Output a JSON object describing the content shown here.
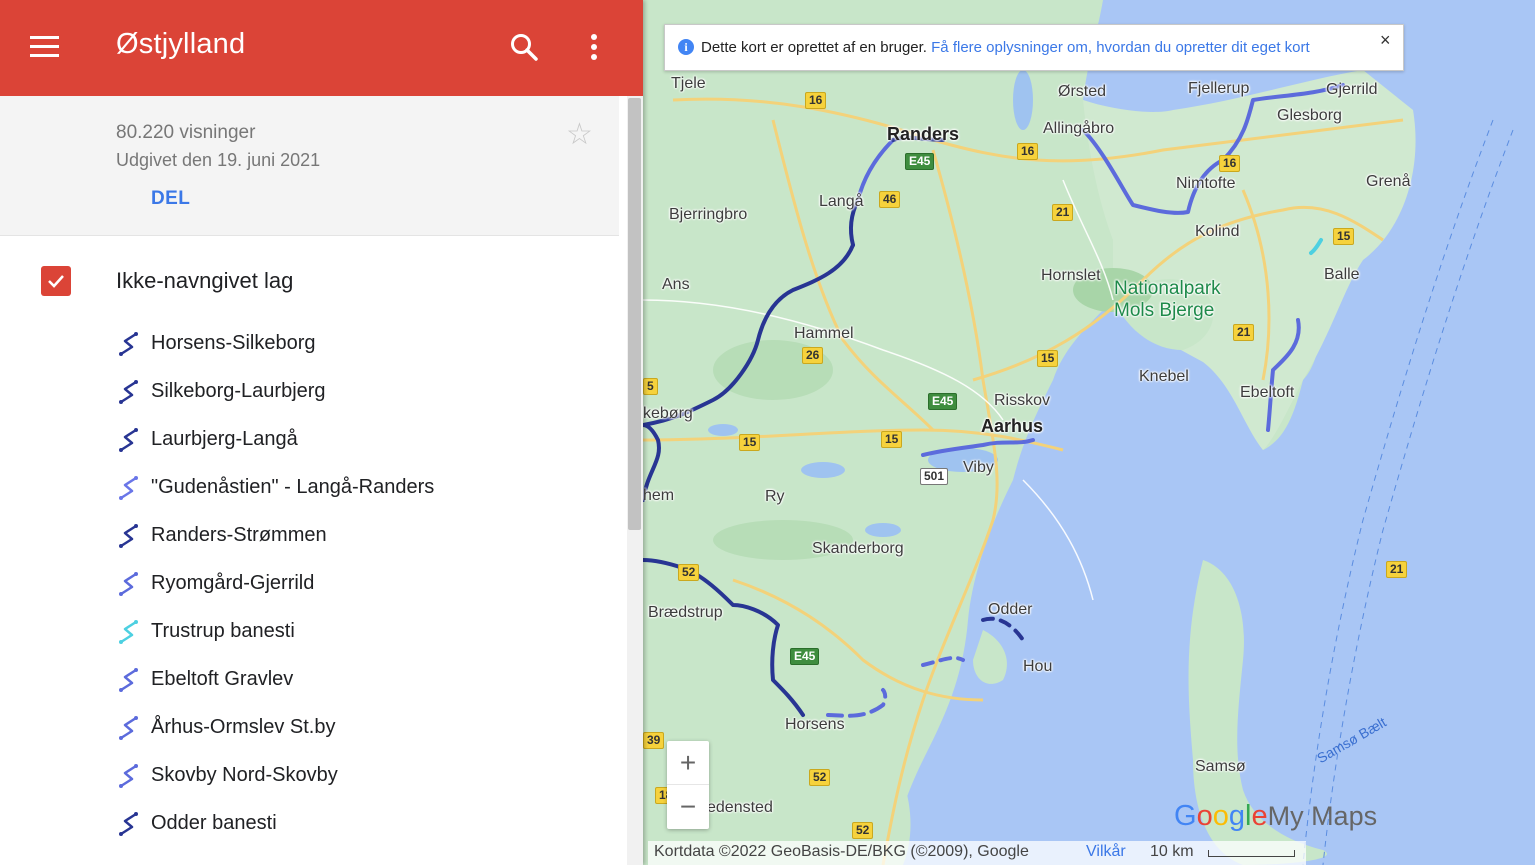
{
  "header": {
    "title": "Østjylland",
    "menu_icon": "menu-icon",
    "search_icon": "search-icon",
    "more_icon": "more-vert-icon",
    "color": "#db4437"
  },
  "info": {
    "views": "80.220 visninger",
    "published": "Udgivet den 19. juni 2021",
    "share_label": "DEL",
    "star_icon": "star-outline-icon"
  },
  "layer": {
    "title": "Ikke-navngivet lag",
    "checked": true,
    "items": [
      {
        "label": "Horsens-Silkeborg",
        "color": "#283593"
      },
      {
        "label": "Silkeborg-Laurbjerg",
        "color": "#283593"
      },
      {
        "label": "Laurbjerg-Langå",
        "color": "#283593"
      },
      {
        "label": "\"Gudenåstien\" - Langå-Randers",
        "color": "#6a76e8"
      },
      {
        "label": "Randers-Strømmen",
        "color": "#283593"
      },
      {
        "label": "Ryomgård-Gjerrild",
        "color": "#5c6bdc"
      },
      {
        "label": "Trustrup banesti",
        "color": "#4dd0e1"
      },
      {
        "label": "Ebeltoft Gravlev",
        "color": "#5c6bdc"
      },
      {
        "label": "Århus-Ormslev St.by",
        "color": "#5c6bdc"
      },
      {
        "label": "Skovby Nord-Skovby",
        "color": "#5c6bdc"
      },
      {
        "label": "Odder banesti",
        "color": "#283593"
      }
    ]
  },
  "banner": {
    "text": "Dette kort er oprettet af en bruger.",
    "link": "Få flere oplysninger om, hvordan du opretter dit eget kort",
    "close": "×"
  },
  "map": {
    "places": [
      {
        "name": "Tjele",
        "cls": ""
      },
      {
        "name": "Randers",
        "cls": "big"
      },
      {
        "name": "Ørsted",
        "cls": ""
      },
      {
        "name": "Fjellerup",
        "cls": ""
      },
      {
        "name": "Gjerrild",
        "cls": ""
      },
      {
        "name": "Allingåbro",
        "cls": ""
      },
      {
        "name": "Glesborg",
        "cls": ""
      },
      {
        "name": "Nimtofte",
        "cls": ""
      },
      {
        "name": "Grenå",
        "cls": ""
      },
      {
        "name": "Langå",
        "cls": ""
      },
      {
        "name": "Bjerringbro",
        "cls": ""
      },
      {
        "name": "Kolind",
        "cls": ""
      },
      {
        "name": "Hornslet",
        "cls": ""
      },
      {
        "name": "Balle",
        "cls": ""
      },
      {
        "name": "Ans",
        "cls": ""
      },
      {
        "name": "Hammel",
        "cls": ""
      },
      {
        "name": "Knebel",
        "cls": ""
      },
      {
        "name": "Ebeltoft",
        "cls": ""
      },
      {
        "name": "Risskov",
        "cls": ""
      },
      {
        "name": "Aarhus",
        "cls": "big"
      },
      {
        "name": "Viby",
        "cls": ""
      },
      {
        "name": "Ry",
        "cls": ""
      },
      {
        "name": "Skanderborg",
        "cls": ""
      },
      {
        "name": "Odder",
        "cls": ""
      },
      {
        "name": "Hou",
        "cls": ""
      },
      {
        "name": "Horsens",
        "cls": ""
      },
      {
        "name": "Samsø",
        "cls": ""
      },
      {
        "name": "kebørg",
        "cls": ""
      },
      {
        "name": "hem",
        "cls": ""
      },
      {
        "name": "Brædstrup",
        "cls": ""
      },
      {
        "name": "edensted",
        "cls": ""
      },
      {
        "name": "Nationalpark Mols Bjerge",
        "cls": "park"
      },
      {
        "name": "Samsø Bælt",
        "cls": "water"
      }
    ],
    "shields": [
      {
        "label": "16",
        "type": "y"
      },
      {
        "label": "E45",
        "type": "g"
      },
      {
        "label": "16",
        "type": "y"
      },
      {
        "label": "16",
        "type": "y"
      },
      {
        "label": "46",
        "type": "y"
      },
      {
        "label": "21",
        "type": "y"
      },
      {
        "label": "15",
        "type": "y"
      },
      {
        "label": "21",
        "type": "y"
      },
      {
        "label": "26",
        "type": "y"
      },
      {
        "label": "15",
        "type": "y"
      },
      {
        "label": "E45",
        "type": "g"
      },
      {
        "label": "15",
        "type": "y"
      },
      {
        "label": "15",
        "type": "y"
      },
      {
        "label": "501",
        "type": "w"
      },
      {
        "label": "52",
        "type": "y"
      },
      {
        "label": "E45",
        "type": "g"
      },
      {
        "label": "21",
        "type": "y"
      },
      {
        "label": "52",
        "type": "y"
      },
      {
        "label": "52",
        "type": "y"
      },
      {
        "label": "5",
        "type": "y"
      },
      {
        "label": "39",
        "type": "y"
      },
      {
        "label": "18",
        "type": "y"
      }
    ],
    "zoom_in": "+",
    "zoom_out": "−",
    "logo": {
      "g1": "G",
      "g2": "o",
      "g3": "o",
      "g4": "g",
      "g5": "l",
      "g6": "e",
      "mm": "My Maps"
    },
    "attribution": {
      "data": "Kortdata ©2022 GeoBasis-DE/BKG (©2009), Google",
      "terms": "Vilkår",
      "scale": "10 km"
    }
  }
}
